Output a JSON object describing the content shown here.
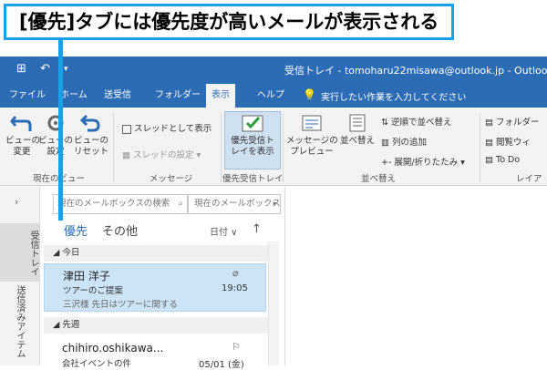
{
  "callout": {
    "text": "[優先]タブには優先度が高いメールが表示される"
  },
  "titlebar": {
    "title": "受信トレイ - tomoharu22misawa@outlook.jp  -  Outlook"
  },
  "tabs": [
    "ファイル",
    "ホーム",
    "送受信",
    "フォルダー",
    "表示",
    "ヘルプ"
  ],
  "active_tab": "表示",
  "tellme": "実行したい作業を入力してください",
  "ribbon": {
    "view_change": "ビューの\n変更",
    "view_settings": "ビューの\n設定",
    "view_reset": "ビューの\nリセット",
    "group_current_view": "現在のビュー",
    "show_as_thread": "スレッドとして表示",
    "thread_settings": "スレッドの設定",
    "group_messages": "メッセージ",
    "focused_inbox": "優先受信ト\nレイを表示",
    "group_focused": "優先受信トレイ",
    "message_preview": "メッセージの\nプレビュー",
    "arrange": "並べ替え",
    "reverse_sort": "逆順で並べ替え",
    "add_column": "列の追加",
    "expand_collapse": "展開/折りたたみ",
    "group_arrangement": "並べ替え",
    "folder": "フォルダー",
    "reading": "閲覧ウィ",
    "todo": "To Do ",
    "group_layout": "レイア"
  },
  "nav": {
    "inbox": "受信トレイ",
    "sent": "送信済みアイテム"
  },
  "search": {
    "placeholder": "現在のメールボックスの検索",
    "scope": "現在のメールボックス"
  },
  "focus_tabs": {
    "focused": "優先",
    "other": "その他"
  },
  "sort": {
    "label": "日付"
  },
  "groups": {
    "today": "今日",
    "last_week": "先週"
  },
  "mails": [
    {
      "sender": "津田 洋子",
      "subject": "ツアーのご提案",
      "time": "19:05",
      "preview": "三沢様  先日はツアーに関する"
    },
    {
      "sender": "chihiro.oshikawa...",
      "subject": "会社イベントの件",
      "time": "05/01 (金)"
    }
  ],
  "colors": {
    "accent": "#2b6cb5",
    "callout": "#1aa0e6",
    "selected": "#cde4f7"
  }
}
